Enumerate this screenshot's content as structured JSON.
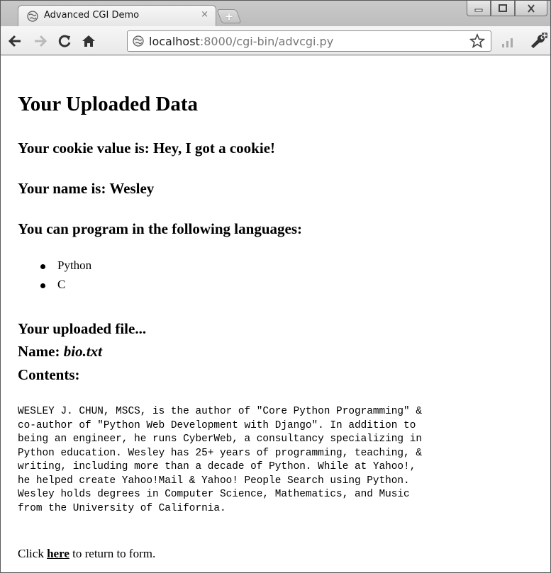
{
  "browser": {
    "tab_title": "Advanced CGI Demo",
    "tab_close": "×",
    "new_tab_label": "+",
    "url_host": "localhost",
    "url_rest": ":8000/cgi-bin/advcgi.py"
  },
  "page": {
    "heading": "Your Uploaded Data",
    "cookie_line": "Your cookie value is: Hey, I got a cookie!",
    "name_line": "Your name is: Wesley",
    "languages_heading": "You can program in the following languages:",
    "languages": [
      "Python",
      "C"
    ],
    "file_heading": "Your uploaded file...",
    "file_name_label": "Name: ",
    "file_name": "bio.txt",
    "contents_label": "Contents:",
    "file_contents": "WESLEY J. CHUN, MSCS, is the author of \"Core Python Programming\" &\nco-author of \"Python Web Development with Django\". In addition to\nbeing an engineer, he runs CyberWeb, a consultancy specializing in\nPython education. Wesley has 25+ years of programming, teaching, &\nwriting, including more than a decade of Python. While at Yahoo!,\nhe helped create Yahoo!Mail & Yahoo! People Search using Python.\nWesley holds degrees in Computer Science, Mathematics, and Music\nfrom the University of California.",
    "footer_prefix": "Click ",
    "footer_link": "here",
    "footer_suffix": " to return to form."
  }
}
